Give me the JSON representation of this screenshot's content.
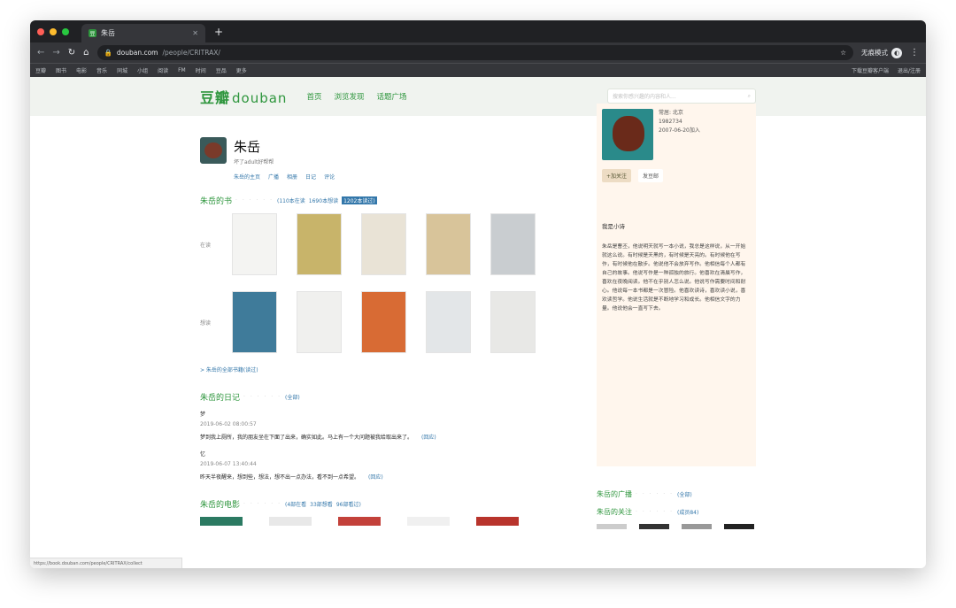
{
  "browser": {
    "tab_title": "朱岳",
    "url_host": "douban.com",
    "url_path": "/people/CRITRAX/",
    "incognito_label": "无痕模式",
    "bookmarks": [
      "豆瓣",
      "图书",
      "电影",
      "音乐",
      "同城",
      "小组",
      "阅读",
      "FM",
      "时间",
      "豆品",
      "更多"
    ],
    "bookmarks_right": [
      "下载豆瓣客户端",
      "退出/注册"
    ],
    "status_text": "https://book.douban.com/people/CRITRAX/collect"
  },
  "douban": {
    "logo_cn": "豆瓣",
    "logo_en": "douban",
    "nav": [
      "首页",
      "浏览发现",
      "话题广场"
    ],
    "search_placeholder": "搜索你感兴趣的内容和人..."
  },
  "profile": {
    "name": "朱岳",
    "sub": "坏了adult好帮帮",
    "tabs": [
      "朱岳的主页",
      "广播",
      "相册",
      "日记",
      "评论"
    ]
  },
  "books": {
    "title": "朱岳的书",
    "dots": "· · · · · ·",
    "links": [
      "(110本在读",
      "1690本想读",
      "1202本读过)"
    ],
    "row_labels": [
      "在读",
      "想读"
    ],
    "row1_colors": [
      "#f4f4f2",
      "#c8b46a",
      "#e9e3d6",
      "#d8c49a",
      "#c9cdd0"
    ],
    "row2_colors": [
      "#3f7b9a",
      "#f0f0ee",
      "#d86b34",
      "#e3e6e8",
      "#e8e8e6"
    ],
    "more": "> 朱岳的全部书籍(读过)"
  },
  "diary": {
    "title": "朱岳的日记",
    "dots": "· · · · · ·",
    "link": "(全部)",
    "entries": [
      {
        "title": "梦",
        "time": "2019-06-02 08:00:57",
        "text": "梦到我上厕所，我的朋友坐在下面了出来，确实如此。马上有一个大问题被我给取出来了。",
        "link": "(回应)"
      },
      {
        "title": "忆",
        "time": "2019-06-07 13:40:44",
        "text": "昨天半夜醒来，想到些，想法，想不出一点办法，看不到一点希望。",
        "link": "(回应)"
      }
    ]
  },
  "films": {
    "title": "朱岳的电影",
    "dots": "· · · · · ·",
    "links": [
      "(4部在看",
      "33部想看",
      "96部看过)"
    ]
  },
  "aside": {
    "info": [
      "常居: 北京",
      "1982734",
      "2007-06-20加入"
    ],
    "btn_follow": "+加关注",
    "btn_msg": "发豆邮",
    "intro_title": "我是小诗",
    "intro": "朱岳是曹丕，他说明天就写一本小说，我总是这样说，从一开始就这么说。有时候是天黑的，有时候是天亮的。有时候他在写作，有时候他在散步。他说他不会放弃写作。他相信每个人都有自己的故事。他说写作是一种孤独的旅行。他喜欢在清晨写作，喜欢在夜晚阅读。他不在乎别人怎么说。他说写作需要时间和耐心。他说每一本书都是一次冒险。他喜欢读诗，喜欢读小说，喜欢读哲学。他说生活就是不断地学习和成长。他相信文字的力量。他说他会一直写下去。"
  },
  "right_sections": [
    {
      "title": "朱岳的广播",
      "link": "(全部)"
    },
    {
      "title": "朱岳的关注",
      "link": "(成员84)"
    }
  ]
}
